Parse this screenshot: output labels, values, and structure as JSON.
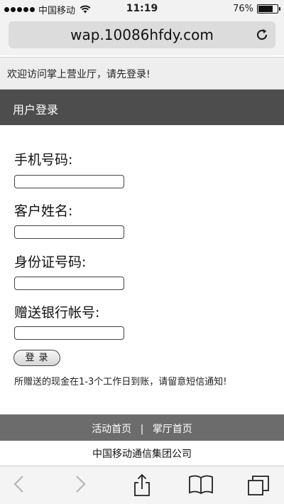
{
  "status_bar": {
    "carrier": "中国移动",
    "time": "11:19",
    "battery_percent": "76%",
    "battery_level": 0.76,
    "icons": [
      "signal-dots",
      "wifi-icon",
      "battery-icon"
    ]
  },
  "address_bar": {
    "url": "wap.10086hfdy.com",
    "reload_icon": "reload-icon"
  },
  "welcome_text": "欢迎访问掌上营业厅，请先登录!",
  "header_title": "用户登录",
  "form": {
    "phone_label": "手机号码:",
    "phone_value": "",
    "name_label": "客户姓名:",
    "name_value": "",
    "id_label": "身份证号码:",
    "id_value": "",
    "bank_label": "赠送银行帐号:",
    "bank_value": "",
    "login_button": "登录"
  },
  "notice": "所赠送的现金在1-3个工作日到账，请留意短信通知!",
  "footer": {
    "link_home": "活动首页",
    "separator": "|",
    "link_hall": "掌厅首页",
    "company": "中国移动通信集团公司"
  },
  "toolbar": {
    "icons": [
      "back-icon",
      "forward-icon",
      "share-icon",
      "bookmarks-icon",
      "tabs-icon"
    ]
  },
  "colors": {
    "header_bg": "#4d4d4d",
    "footer_bg": "#6c6c6c",
    "welcome_bg": "#eeeeee"
  }
}
